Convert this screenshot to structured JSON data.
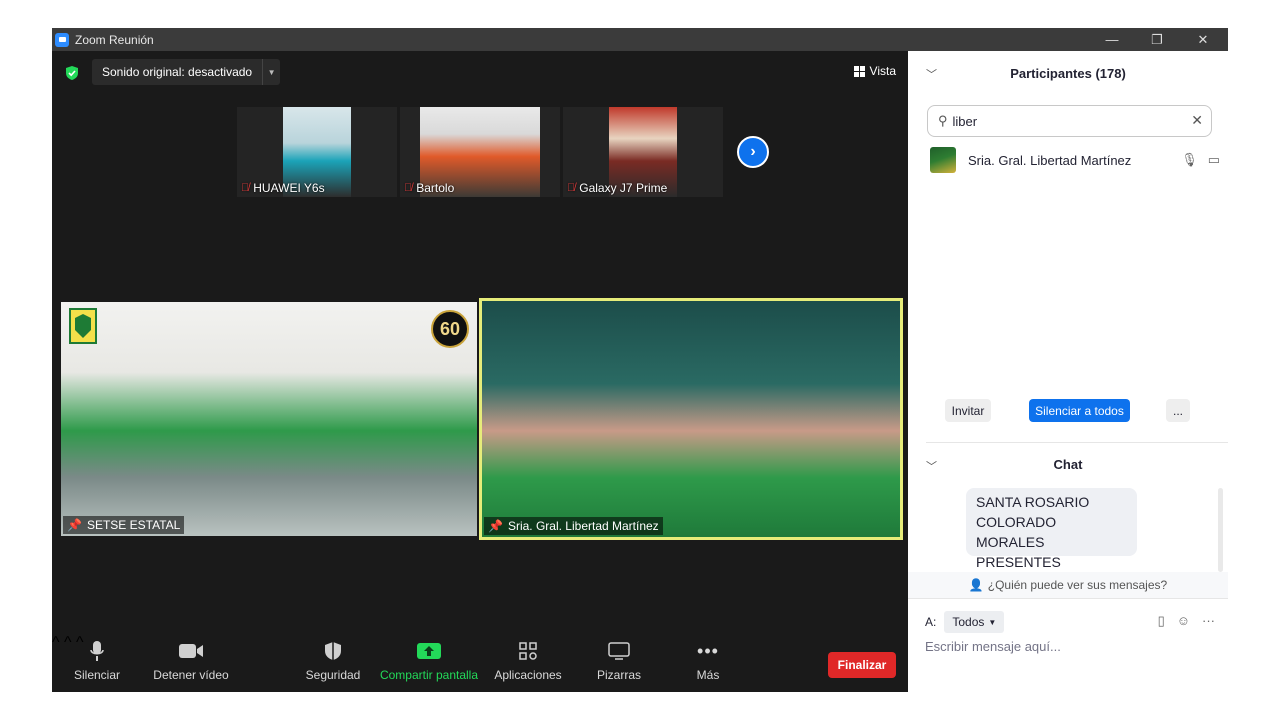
{
  "window": {
    "title": "Zoom Reunión",
    "controls": {
      "minimize": "—",
      "restore": "❐",
      "close": "✕"
    }
  },
  "top_bar": {
    "sound_label": "Sonido original: desactivado",
    "view_label": "Vista"
  },
  "thumbnails": [
    {
      "name": "HUAWEI Y6s"
    },
    {
      "name": "Bartolo"
    },
    {
      "name": "Galaxy J7 Prime"
    }
  ],
  "tiles": [
    {
      "name": "SETSE ESTATAL",
      "badge": "60"
    },
    {
      "name": "Sria. Gral. Libertad Martínez"
    }
  ],
  "toolbar": {
    "mute": "Silenciar",
    "video": "Detener vídeo",
    "security": "Seguridad",
    "share": "Compartir pantalla",
    "apps": "Aplicaciones",
    "whiteboards": "Pizarras",
    "more": "Más",
    "end": "Finalizar"
  },
  "participants": {
    "header": "Participantes (178)",
    "search_value": "liber",
    "list": [
      {
        "name": "Sria. Gral. Libertad Martínez"
      }
    ],
    "invite": "Invitar",
    "mute_all": "Silenciar a todos",
    "more": "..."
  },
  "chat": {
    "header": "Chat",
    "message_lines": [
      "SANTA ROSARIO",
      "COLORADO MORALES",
      "PRESENTES"
    ],
    "who_can_see": "¿Quién puede ver sus mensajes?",
    "to_label": "A:",
    "to_value": "Todos",
    "placeholder": "Escribir mensaje aquí..."
  },
  "colors": {
    "accent_blue": "#0e72ed",
    "share_green": "#23d959",
    "end_red": "#e02828",
    "active_speaker_border": "#e6ec7a"
  }
}
